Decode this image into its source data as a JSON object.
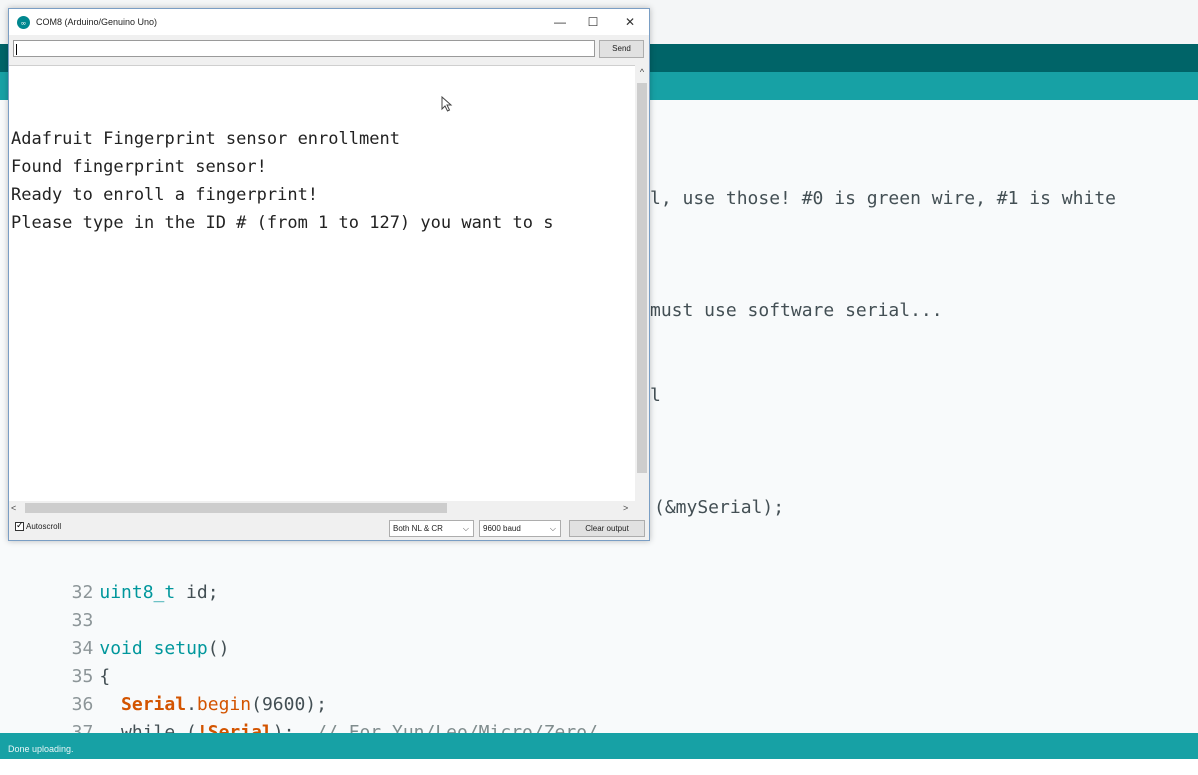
{
  "serial_window": {
    "title": "COM8 (Arduino/Genuino Uno)",
    "minimize": "—",
    "maximize": "☐",
    "close": "✕",
    "input_value": "",
    "send_label": "Send",
    "output_lines": [
      "Adafruit Fingerprint sensor enrollment",
      "Found fingerprint sensor!",
      "Ready to enroll a fingerprint!",
      "Please type in the ID # (from 1 to 127) you want to s"
    ],
    "autoscroll_label": "Autoscroll",
    "autoscroll_checked": true,
    "line_ending": "Both NL & CR",
    "baud": "9600 baud",
    "clear_label": "Clear output",
    "scroll_up": "^",
    "scroll_left": "<",
    "scroll_right": ">"
  },
  "editor": {
    "fragments": {
      "f1": "l, use those! #0 is green wire, #1 is white",
      "f2": "must use software serial...",
      "f3": "l",
      "f4": "(&mySerial);"
    },
    "lines": [
      {
        "num": "32",
        "a": "uint8_t",
        "b": " id;"
      },
      {
        "num": "33"
      },
      {
        "num": "34",
        "a": "void",
        "b": " ",
        "c": "setup",
        "d": "()"
      },
      {
        "num": "35",
        "b": "{"
      },
      {
        "num": "36",
        "b": "  ",
        "c": "Serial",
        "d": ".",
        "e": "begin",
        "f": "(9600);"
      },
      {
        "num": "37",
        "b": "  while (",
        "c": "!Serial",
        "d": ");  ",
        "e": "// For Yun/Leo/Micro/Zero/..."
      }
    ]
  },
  "status": {
    "text": "Done uploading."
  },
  "colors": {
    "ide_dark": "#006468",
    "ide_teal": "#17a1a5",
    "keyword_type": "#00979c",
    "keyword_fn": "#d35400"
  }
}
